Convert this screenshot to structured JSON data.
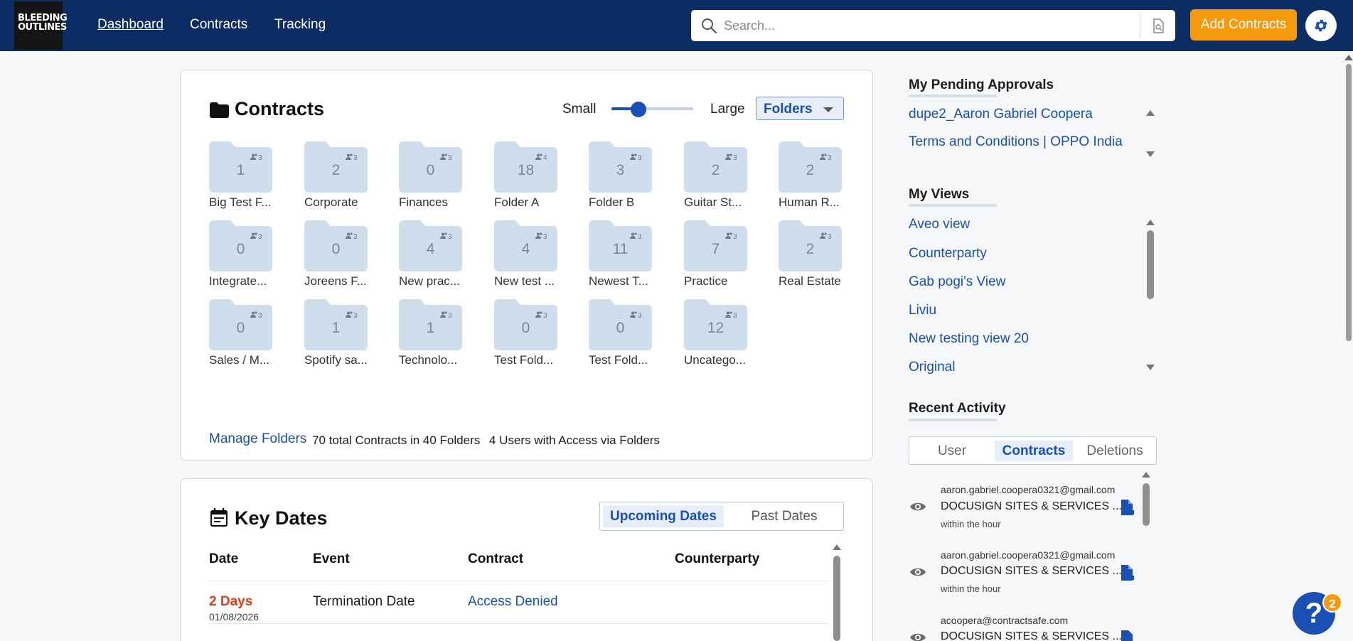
{
  "nav": {
    "logo_text": "BLEEDING OUTLINES",
    "links": [
      "Dashboard",
      "Contracts",
      "Tracking"
    ],
    "search_placeholder": "Search...",
    "add_button": "Add Contracts"
  },
  "contracts_card": {
    "title": "Contracts",
    "size_small": "Small",
    "size_large": "Large",
    "slider_value_fraction": 0.33,
    "view_mode": "Folders",
    "folders": [
      {
        "count": "1",
        "users": "3",
        "name": "Big Test F..."
      },
      {
        "count": "2",
        "users": "3",
        "name": "Corporate"
      },
      {
        "count": "0",
        "users": "3",
        "name": "Finances"
      },
      {
        "count": "18",
        "users": "4",
        "name": "Folder A"
      },
      {
        "count": "3",
        "users": "3",
        "name": "Folder B"
      },
      {
        "count": "2",
        "users": "3",
        "name": "Guitar St..."
      },
      {
        "count": "2",
        "users": "3",
        "name": "Human R..."
      },
      {
        "count": "0",
        "users": "3",
        "name": "Integrate..."
      },
      {
        "count": "0",
        "users": "3",
        "name": "Joreens F..."
      },
      {
        "count": "4",
        "users": "3",
        "name": "New prac..."
      },
      {
        "count": "4",
        "users": "3",
        "name": "New test ..."
      },
      {
        "count": "11",
        "users": "3",
        "name": "Newest T..."
      },
      {
        "count": "7",
        "users": "3",
        "name": "Practice"
      },
      {
        "count": "2",
        "users": "3",
        "name": "Real Estate"
      },
      {
        "count": "0",
        "users": "3",
        "name": "Sales / M..."
      },
      {
        "count": "1",
        "users": "3",
        "name": "Spotify sa..."
      },
      {
        "count": "1",
        "users": "3",
        "name": "Technolo..."
      },
      {
        "count": "0",
        "users": "3",
        "name": "Test Fold..."
      },
      {
        "count": "0",
        "users": "3",
        "name": "Test Fold..."
      },
      {
        "count": "12",
        "users": "3",
        "name": "Uncatego..."
      }
    ],
    "manage_link": "Manage Folders",
    "total_text": "70 total Contracts in 40 Folders",
    "users_text": "4 Users with Access via Folders"
  },
  "key_dates": {
    "title": "Key Dates",
    "tab_upcoming": "Upcoming Dates",
    "tab_past": "Past Dates",
    "headers": {
      "date": "Date",
      "event": "Event",
      "contract": "Contract",
      "counterparty": "Counterparty"
    },
    "rows": [
      {
        "relative": "2 Days",
        "date": "01/08/2026",
        "event": "Termination Date",
        "contract": "Access Denied",
        "counterparty": ""
      }
    ]
  },
  "sidebar": {
    "pending_title": "My Pending Approvals",
    "pending": [
      "dupe2_Aaron Gabriel Coopera",
      "Terms and Conditions | OPPO India"
    ],
    "views_title": "My Views",
    "views": [
      "Aveo view",
      "Counterparty",
      "Gab pogi's View",
      "Liviu",
      "New testing view 20",
      "Original"
    ],
    "activity_title": "Recent Activity",
    "activity_tabs": [
      "User",
      "Contracts",
      "Deletions"
    ],
    "activity": [
      {
        "email": "aaron.gabriel.coopera0321@gmail.com",
        "title": "DOCUSIGN SITES & SERVICES ...",
        "time": "within the hour"
      },
      {
        "email": "aaron.gabriel.coopera0321@gmail.com",
        "title": "DOCUSIGN SITES & SERVICES ...",
        "time": "within the hour"
      },
      {
        "email": "acoopera@contractsafe.com",
        "title": "DOCUSIGN SITES & SERVICES ...",
        "time": ""
      }
    ]
  },
  "help": {
    "label": "?",
    "badge": "2"
  },
  "colors": {
    "nav_bg": "#0c2d63",
    "accent": "#1a4fb6",
    "cta": "#f59a0c",
    "folder": "#cfdeec",
    "due_red": "#e23a18"
  }
}
